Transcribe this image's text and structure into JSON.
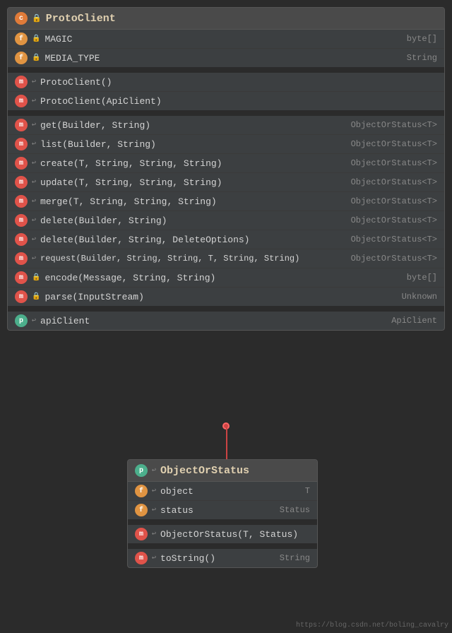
{
  "proto_client": {
    "header": {
      "icon_type": "c",
      "name": "ProtoClient"
    },
    "fields": [
      {
        "icon_type": "f",
        "locked": true,
        "name": "MAGIC",
        "type": "byte[]"
      },
      {
        "icon_type": "f",
        "locked": true,
        "name": "MEDIA_TYPE",
        "type": "String"
      }
    ],
    "constructors": [
      {
        "icon_type": "m",
        "locked": false,
        "name": "ProtoClient()",
        "type": ""
      },
      {
        "icon_type": "m",
        "locked": false,
        "name": "ProtoClient(ApiClient)",
        "type": ""
      }
    ],
    "methods": [
      {
        "icon_type": "m",
        "locked": false,
        "name": "get(Builder, String)",
        "type": "ObjectOrStatus<T>"
      },
      {
        "icon_type": "m",
        "locked": false,
        "name": "list(Builder, String)",
        "type": "ObjectOrStatus<T>"
      },
      {
        "icon_type": "m",
        "locked": false,
        "name": "create(T, String, String, String)",
        "type": "ObjectOrStatus<T>"
      },
      {
        "icon_type": "m",
        "locked": false,
        "name": "update(T, String, String, String)",
        "type": "ObjectOrStatus<T>"
      },
      {
        "icon_type": "m",
        "locked": false,
        "name": "merge(T, String, String, String)",
        "type": "ObjectOrStatus<T>"
      },
      {
        "icon_type": "m",
        "locked": false,
        "name": "delete(Builder, String)",
        "type": "ObjectOrStatus<T>"
      },
      {
        "icon_type": "m",
        "locked": false,
        "name": "delete(Builder, String, DeleteOptions)",
        "type": "ObjectOrStatus<T>"
      },
      {
        "icon_type": "m",
        "locked": false,
        "name": "request(Builder, String, String, T, String, String)",
        "type": "ObjectOrStatus<T>"
      },
      {
        "icon_type": "m",
        "locked": true,
        "name": "encode(Message, String, String)",
        "type": "byte[]"
      },
      {
        "icon_type": "m",
        "locked": true,
        "name": "parse(InputStream)",
        "type": "Unknown"
      }
    ],
    "properties": [
      {
        "icon_type": "p",
        "locked": false,
        "name": "apiClient",
        "type": "ApiClient"
      }
    ]
  },
  "object_or_status": {
    "header": {
      "icon_type": "p",
      "name": "ObjectOrStatus"
    },
    "fields": [
      {
        "icon_type": "f",
        "locked": false,
        "name": "object",
        "type": "T"
      },
      {
        "icon_type": "f",
        "locked": false,
        "name": "status",
        "type": "Status"
      }
    ],
    "constructors": [
      {
        "icon_type": "m",
        "locked": false,
        "name": "ObjectOrStatus(T, Status)",
        "type": ""
      }
    ],
    "methods": [
      {
        "icon_type": "m",
        "locked": false,
        "name": "toString()",
        "type": "String"
      }
    ]
  },
  "watermark": "https://blog.csdn.net/boling_cavalry"
}
